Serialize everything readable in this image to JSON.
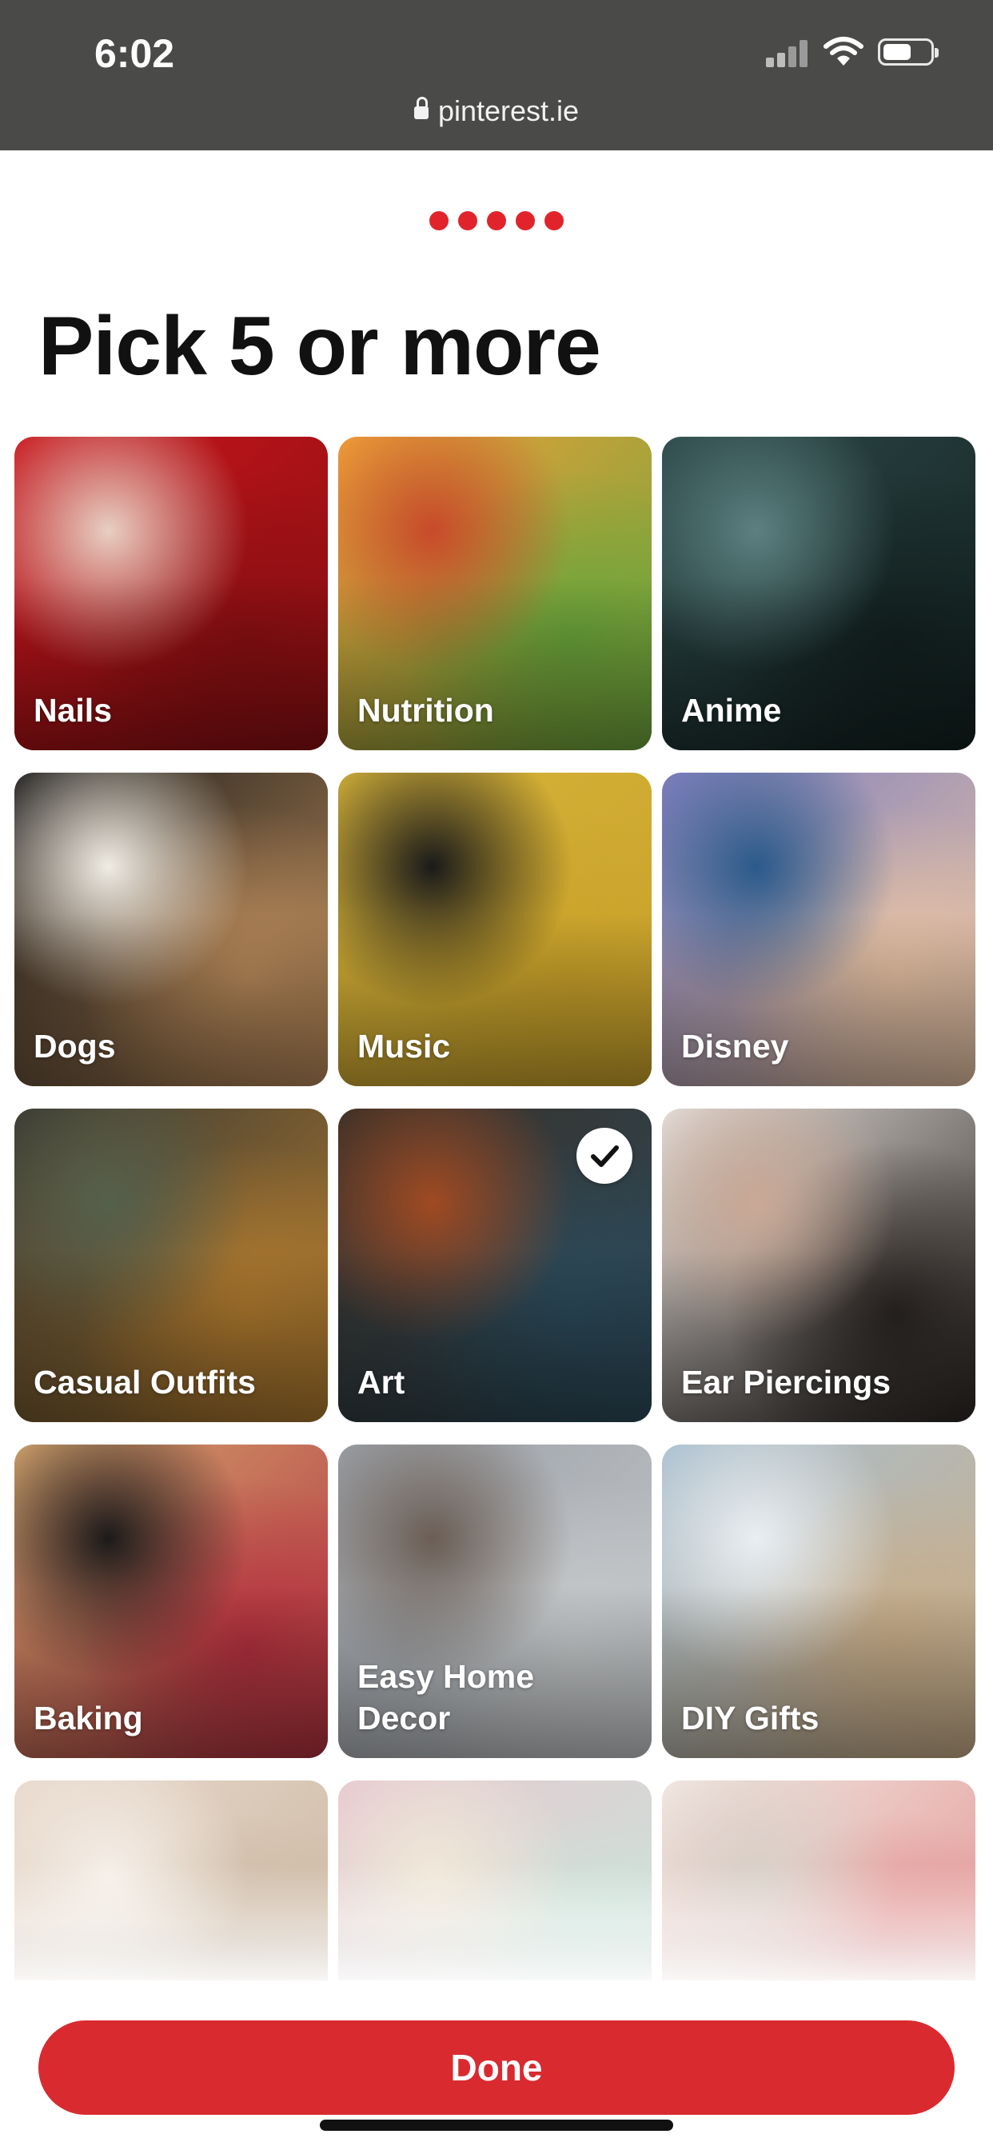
{
  "status_bar": {
    "time": "6:02",
    "url": "pinterest.ie",
    "icons": [
      "signal-icon",
      "wifi-icon",
      "battery-icon",
      "lock-icon"
    ]
  },
  "progress": {
    "dots": 5,
    "color": "#e1242b"
  },
  "title": "Pick 5 or more",
  "topics": [
    {
      "label": "Nails",
      "selected": false,
      "colors": [
        "#c9151c",
        "#8a0f12",
        "#e8cfc2"
      ]
    },
    {
      "label": "Nutrition",
      "selected": false,
      "colors": [
        "#f2a03a",
        "#6aa53b",
        "#c84a2a"
      ]
    },
    {
      "label": "Anime",
      "selected": false,
      "colors": [
        "#2e4a4a",
        "#12201f",
        "#5c8080"
      ]
    },
    {
      "label": "Dogs",
      "selected": false,
      "colors": [
        "#1a1a1a",
        "#b98a5a",
        "#f0ece4"
      ]
    },
    {
      "label": "Music",
      "selected": false,
      "colors": [
        "#d7b43a",
        "#c9a22a",
        "#1a1a1a"
      ]
    },
    {
      "label": "Disney",
      "selected": false,
      "colors": [
        "#7f7fbf",
        "#e8c3a3",
        "#2b5a8a"
      ]
    },
    {
      "label": "Casual Outfits",
      "selected": false,
      "colors": [
        "#3a3a34",
        "#b07a2e",
        "#55604c"
      ]
    },
    {
      "label": "Art",
      "selected": true,
      "colors": [
        "#3a2f26",
        "#2b4a5a",
        "#a04a22"
      ]
    },
    {
      "label": "Ear Piercings",
      "selected": false,
      "colors": [
        "#e6e0dc",
        "#2a2522",
        "#c9a895"
      ]
    },
    {
      "label": "Baking",
      "selected": false,
      "colors": [
        "#d4a870",
        "#b3303e",
        "#1c1a1a"
      ]
    },
    {
      "label": "Easy Home Decor",
      "selected": false,
      "colors": [
        "#9a9fa6",
        "#c7cacc",
        "#6b5e55"
      ]
    },
    {
      "label": "DIY Gifts",
      "selected": false,
      "colors": [
        "#a8bfd0",
        "#c9ad88",
        "#e9eef2"
      ]
    },
    {
      "label": "",
      "selected": false,
      "colors": [
        "#e9d9cd",
        "#c7b39c",
        "#f5efe8"
      ]
    },
    {
      "label": "",
      "selected": false,
      "colors": [
        "#e8c8d0",
        "#c6e6da",
        "#f0e8d8"
      ]
    },
    {
      "label": "",
      "selected": false,
      "colors": [
        "#f2e9e3",
        "#e08a8a",
        "#d8d0c8"
      ]
    }
  ],
  "done_label": "Done"
}
